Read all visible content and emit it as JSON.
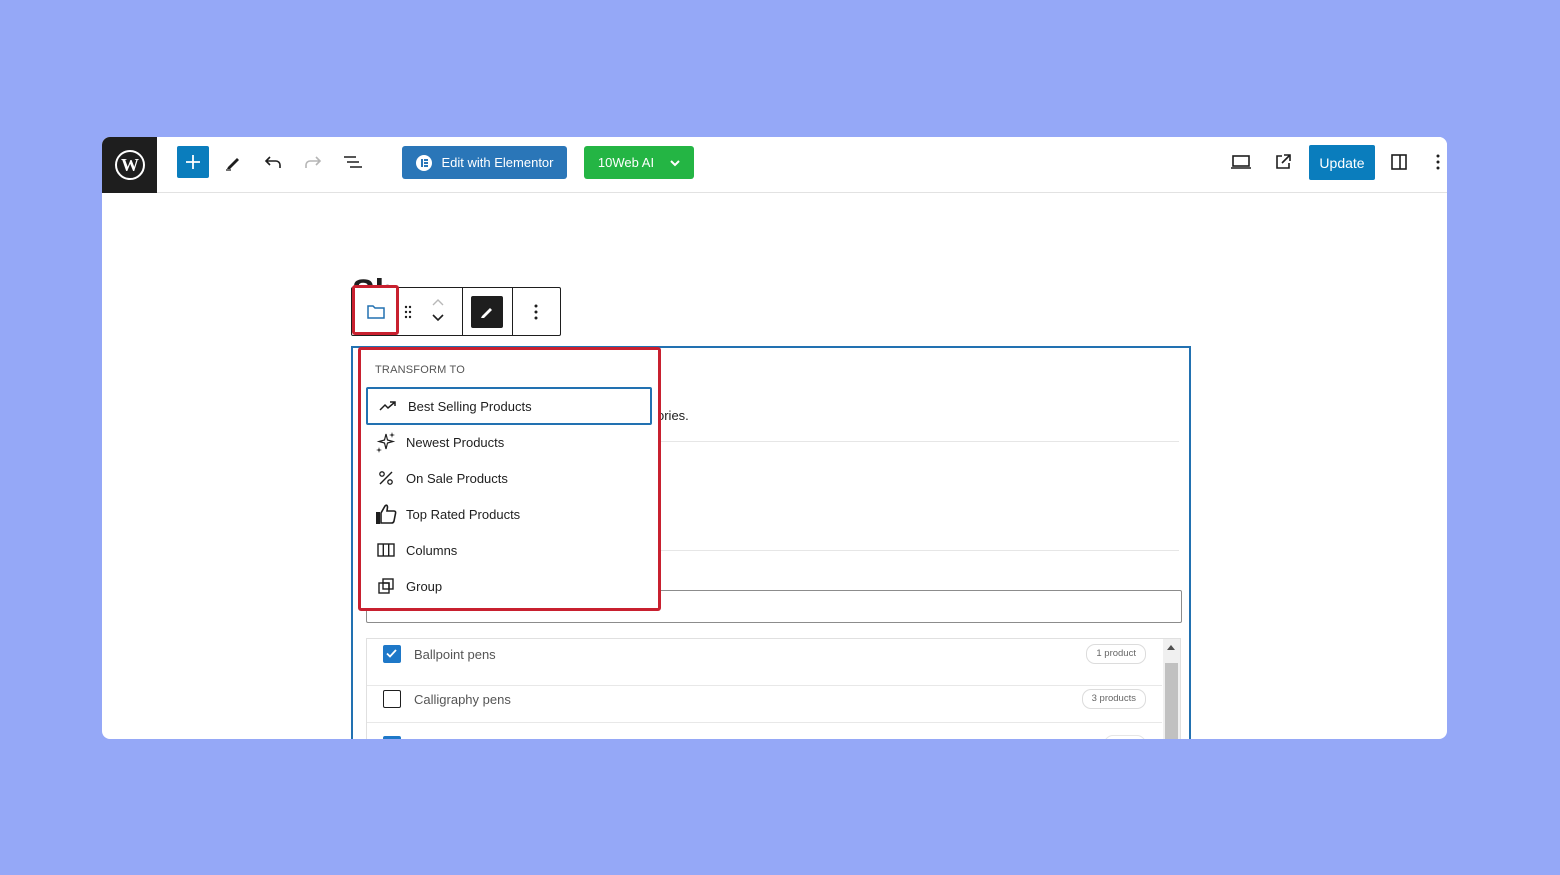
{
  "toolbar": {
    "add_icon": "plus-icon",
    "tools_icon": "pencil-icon",
    "undo_icon": "undo-icon",
    "redo_icon": "redo-icon",
    "list_view_icon": "list-view-icon",
    "elementor_label": "Edit with Elementor",
    "tenweb_label": "10Web AI",
    "preview_icon": "laptop-icon",
    "view_post_icon": "external-link-icon",
    "update_label": "Update",
    "settings_icon": "sidebar-toggle-icon",
    "options_icon": "vertical-ellipsis-icon"
  },
  "editor": {
    "title_fragment": "Sh",
    "block_description_fragment": "ories."
  },
  "transform_menu": {
    "heading": "TRANSFORM TO",
    "items": [
      {
        "label": "Best Selling Products",
        "icon": "trending-up-icon"
      },
      {
        "label": "Newest Products",
        "icon": "sparkles-icon"
      },
      {
        "label": "On Sale Products",
        "icon": "percent-icon"
      },
      {
        "label": "Top Rated Products",
        "icon": "thumbs-up-icon"
      },
      {
        "label": "Columns",
        "icon": "columns-icon"
      },
      {
        "label": "Group",
        "icon": "group-icon"
      }
    ]
  },
  "categories": [
    {
      "label": "Ballpoint pens",
      "count": "1 product",
      "checked": true
    },
    {
      "label": "Calligraphy pens",
      "count": "3 products",
      "checked": false
    },
    {
      "label": "",
      "count": "",
      "checked": true
    }
  ],
  "colors": {
    "page_background": "#95a8f7",
    "accent_blue": "#0a7dbd",
    "tenweb_green": "#24b544",
    "highlight_red": "#c8202f"
  }
}
